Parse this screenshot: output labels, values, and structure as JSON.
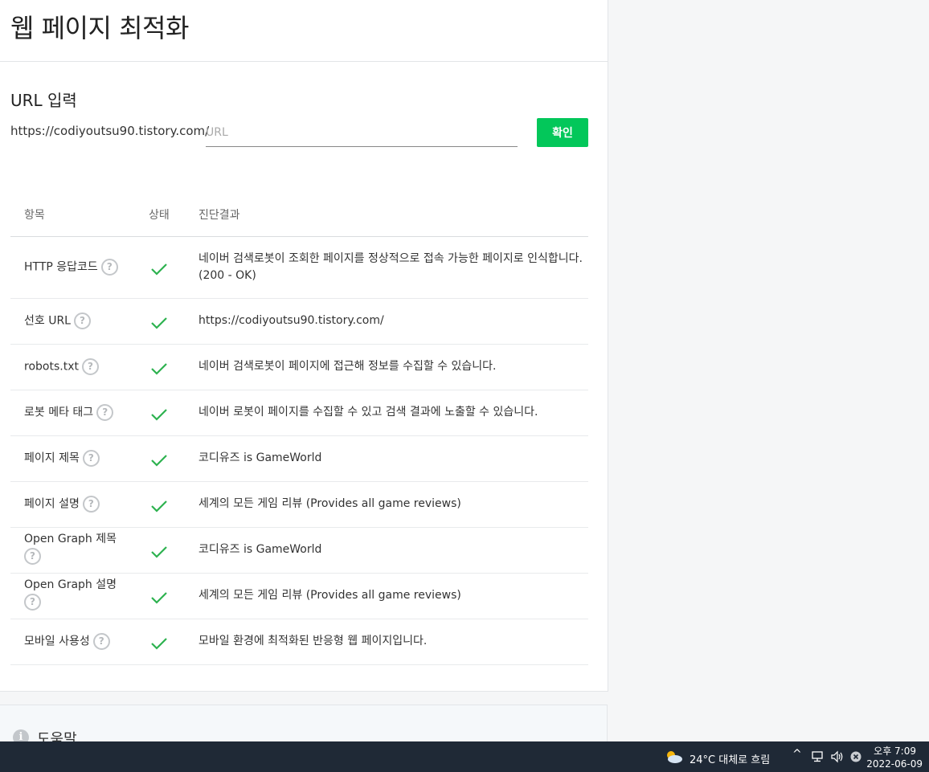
{
  "page_title": "웹 페이지 최적화",
  "url_section": {
    "title": "URL 입력",
    "prefix": "https://codiyoutsu90.tistory.com/",
    "input_value": "",
    "input_placeholder": "URL",
    "confirm_label": "확인"
  },
  "table": {
    "headers": {
      "item": "항목",
      "status": "상태",
      "result": "진단결과"
    },
    "rows": [
      {
        "label": "HTTP 응답코드",
        "result": "네이버 검색로봇이 조회한 페이지를 정상적으로 접속 가능한 페이지로 인식합니다.(200 - OK)"
      },
      {
        "label": "선호 URL",
        "result": "https://codiyoutsu90.tistory.com/"
      },
      {
        "label": "robots.txt",
        "result": "네이버 검색로봇이 페이지에 접근해 정보를 수집할 수 있습니다."
      },
      {
        "label": "로봇 메타 태그",
        "result": "네이버 로봇이 페이지를 수집할 수 있고 검색 결과에 노출할 수 있습니다."
      },
      {
        "label": "페이지 제목",
        "result": "코디유즈 is GameWorld"
      },
      {
        "label": "페이지 설명",
        "result": "세계의 모든 게임 리뷰 (Provides all game reviews)"
      },
      {
        "label": "Open Graph 제목",
        "result": "코디유즈 is GameWorld"
      },
      {
        "label": "Open Graph 설명",
        "result": "세계의 모든 게임 리뷰 (Provides all game reviews)"
      },
      {
        "label": "모바일 사용성",
        "result": "모바일 환경에 최적화된 반응형 웹 페이지입니다."
      }
    ]
  },
  "help": {
    "title": "도움말"
  },
  "icons": {
    "help": "question-circle-icon",
    "status": "check-icon",
    "info": "info-icon"
  },
  "colors": {
    "accent": "#03c75a",
    "check": "#2db24f",
    "taskbar": "#1f2936"
  },
  "taskbar": {
    "weather": "24°C  대체로 흐림",
    "time": "오후 7:09",
    "date": "2022-06-09"
  }
}
